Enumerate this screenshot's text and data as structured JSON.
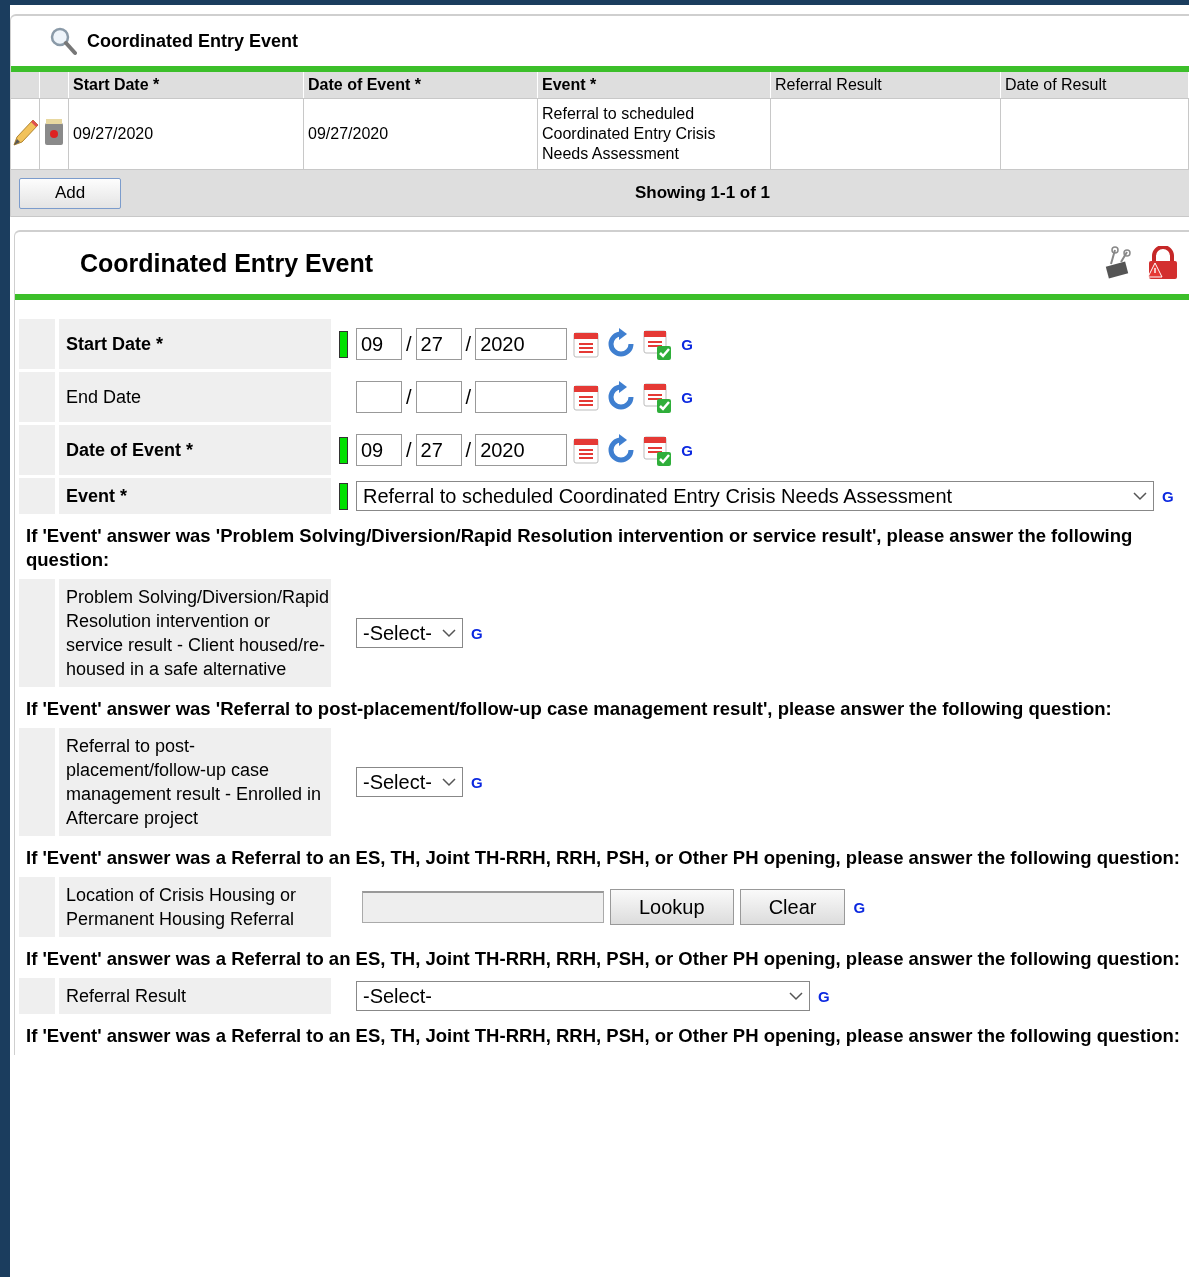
{
  "list_panel": {
    "title": "Coordinated Entry Event",
    "columns": [
      {
        "label": "Start Date",
        "required": true,
        "required_mark": "*"
      },
      {
        "label": "Date of Event",
        "required": true,
        "required_mark": "*"
      },
      {
        "label": "Event",
        "required": true,
        "required_mark": "*"
      },
      {
        "label": "Referral Result",
        "required": false
      },
      {
        "label": "Date of Result",
        "required": false
      }
    ],
    "rows": [
      {
        "cells": [
          "09/27/2020",
          "09/27/2020",
          "Referral to scheduled Coordinated Entry Crisis Needs Assessment"
        ]
      }
    ],
    "add_button": "Add",
    "paging": "Showing 1-1 of 1"
  },
  "form": {
    "title": "Coordinated Entry Event",
    "items": [
      {
        "kind": "date",
        "label": "Start Date",
        "required": true,
        "required_mark": "*",
        "month": "09",
        "day": "27",
        "year": "2020",
        "separators": [
          "/",
          "/"
        ],
        "g_link": "G"
      },
      {
        "kind": "date",
        "label": "End Date",
        "required": false,
        "separators": [
          "/",
          "/"
        ],
        "g_link": "G"
      },
      {
        "kind": "date",
        "label": "Date of Event",
        "required": true,
        "required_mark": "*",
        "month": "09",
        "day": "27",
        "year": "2020",
        "separators": [
          "/",
          "/"
        ],
        "g_link": "G"
      },
      {
        "kind": "select",
        "label": "Event",
        "required": true,
        "required_mark": "*",
        "value": "Referral to scheduled Coordinated Entry Crisis Needs Assessment",
        "g_link": "G"
      },
      {
        "kind": "heading",
        "text": "If 'Event' answer was 'Problem Solving/Diversion/Rapid Resolution intervention or service result', please answer the following question:"
      },
      {
        "kind": "select",
        "label": "Problem Solving/Diversion/Rapid Resolution intervention or service result - Client housed/re-housed in a safe alternative",
        "required": false,
        "value": "-Select-",
        "g_link": "G"
      },
      {
        "kind": "heading",
        "text": "If 'Event' answer was 'Referral to post-placement/follow-up case management result', please answer the following question:"
      },
      {
        "kind": "select",
        "label": "Referral to post-placement/follow-up case management result - Enrolled in Aftercare project",
        "required": false,
        "value": "-Select-",
        "g_link": "G"
      },
      {
        "kind": "heading",
        "text": "If 'Event' answer was a Referral to an ES, TH, Joint TH-RRH, RRH, PSH, or Other PH opening, please answer the following question:"
      },
      {
        "kind": "lookup",
        "label": "Location of Crisis Housing or Permanent Housing Referral",
        "required": false,
        "buttons": [
          "Lookup",
          "Clear"
        ],
        "g_link": "G"
      },
      {
        "kind": "heading",
        "text": "If 'Event' answer was a Referral to an ES, TH, Joint TH-RRH, RRH, PSH, or Other PH opening, please answer the following question:"
      },
      {
        "kind": "wide-select",
        "label": "Referral Result",
        "required": false,
        "value": "-Select-",
        "g_link": "G"
      },
      {
        "kind": "heading",
        "text": "If 'Event' answer was a Referral to an ES, TH, Joint TH-RRH, RRH, PSH, or Other PH opening, please answer the following question:"
      }
    ]
  }
}
